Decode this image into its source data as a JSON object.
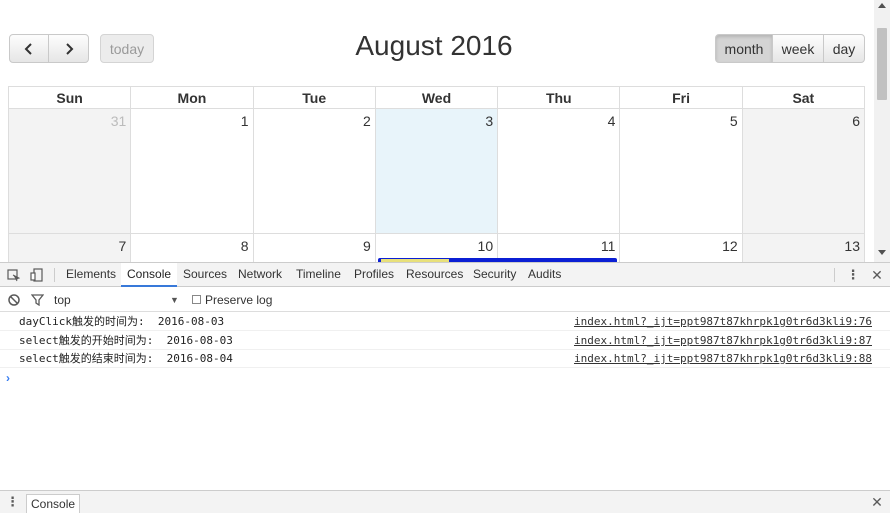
{
  "calendar": {
    "title": "August 2016",
    "prev_label": "‹",
    "next_label": "›",
    "today_label": "today",
    "views": {
      "month": "month",
      "week": "week",
      "day": "day"
    },
    "active_view": "month",
    "weekdays": [
      "Sun",
      "Mon",
      "Tue",
      "Wed",
      "Thu",
      "Fri",
      "Sat"
    ],
    "weeks": [
      [
        "31",
        "1",
        "2",
        "3",
        "4",
        "5",
        "6"
      ],
      [
        "7",
        "8",
        "9",
        "10",
        "11",
        "12",
        "13"
      ]
    ],
    "today": "3",
    "colors": {
      "today_bg": "#e8f4fa",
      "event": "#0b1fd4",
      "weekend_bg": "#f3f3f3"
    }
  },
  "devtools": {
    "tabs": [
      "Elements",
      "Console",
      "Sources",
      "Network",
      "Timeline",
      "Profiles",
      "Resources",
      "Security",
      "Audits"
    ],
    "active_tab": "Console",
    "icons": {
      "inspect": "inspect-element-icon",
      "device": "device-mode-icon",
      "menu": "kebab-menu-icon",
      "close": "close-icon",
      "clear": "clear-console-icon",
      "filter": "filter-icon"
    },
    "context": "top",
    "preserve_log_label": "Preserve log",
    "logs": [
      {
        "message": "dayClick触发的时间为:  2016-08-03",
        "source": "index.html?_ijt=ppt987t87khrpk1g0tr6d3kli9:76"
      },
      {
        "message": "select触发的开始时间为:  2016-08-03",
        "source": "index.html?_ijt=ppt987t87khrpk1g0tr6d3kli9:87"
      },
      {
        "message": "select触发的结束时间为:  2016-08-04",
        "source": "index.html?_ijt=ppt987t87khrpk1g0tr6d3kli9:88"
      }
    ],
    "prompt": "›",
    "drawer_tab": "Console"
  }
}
